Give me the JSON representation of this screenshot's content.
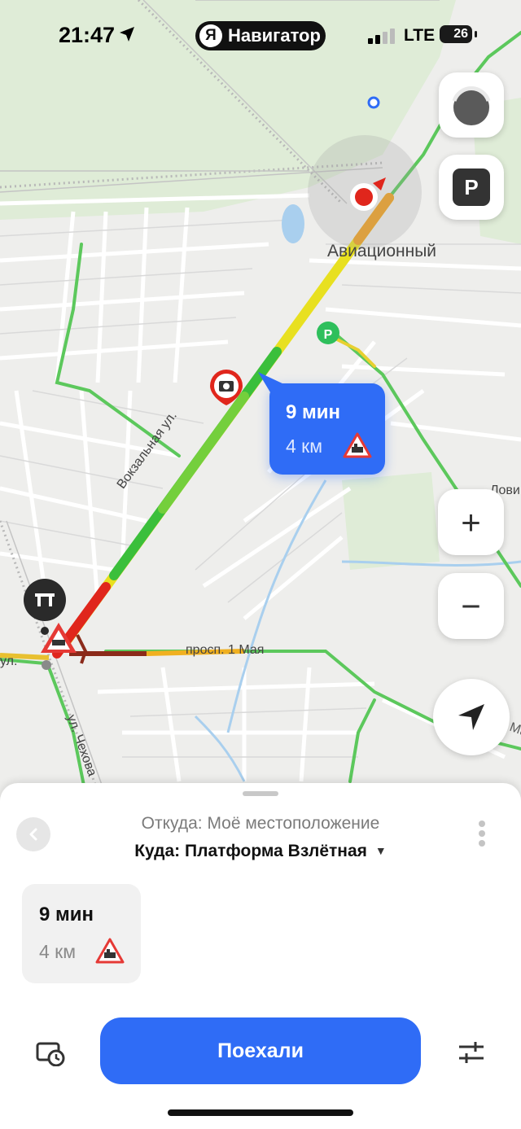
{
  "status_bar": {
    "time": "21:47",
    "app_name": "Навигатор",
    "app_logo_letter": "Я",
    "network": "LTE",
    "battery": "26"
  },
  "map": {
    "place_label": "Авиационный",
    "street_vokzalnaya": "Вокзальная ул.",
    "street_1maya": "просп. 1 Мая",
    "street_chekhova": "ул. Чехова",
    "street_edge_left": "ул.",
    "street_edge_right": "Лови",
    "street_prosp_right": "просп. 1 Мая"
  },
  "route_bubble": {
    "time": "9 мин",
    "distance": "4 км"
  },
  "sheet": {
    "from_text": "Откуда: Моё местоположение",
    "to_text": "Куда: Платформа Взлётная",
    "route_card": {
      "time": "9 мин",
      "distance": "4 км"
    },
    "go_label": "Поехали"
  },
  "icons": {
    "sidebar_top": "traffic-toggle-icon",
    "parking": "P",
    "zoom_in": "+",
    "zoom_out": "−"
  },
  "colors": {
    "accent": "#2f6cf6",
    "route_green": "#3bbf3b",
    "route_yellow": "#e8e020",
    "route_red": "#e0261c",
    "warning": "#e53935"
  }
}
